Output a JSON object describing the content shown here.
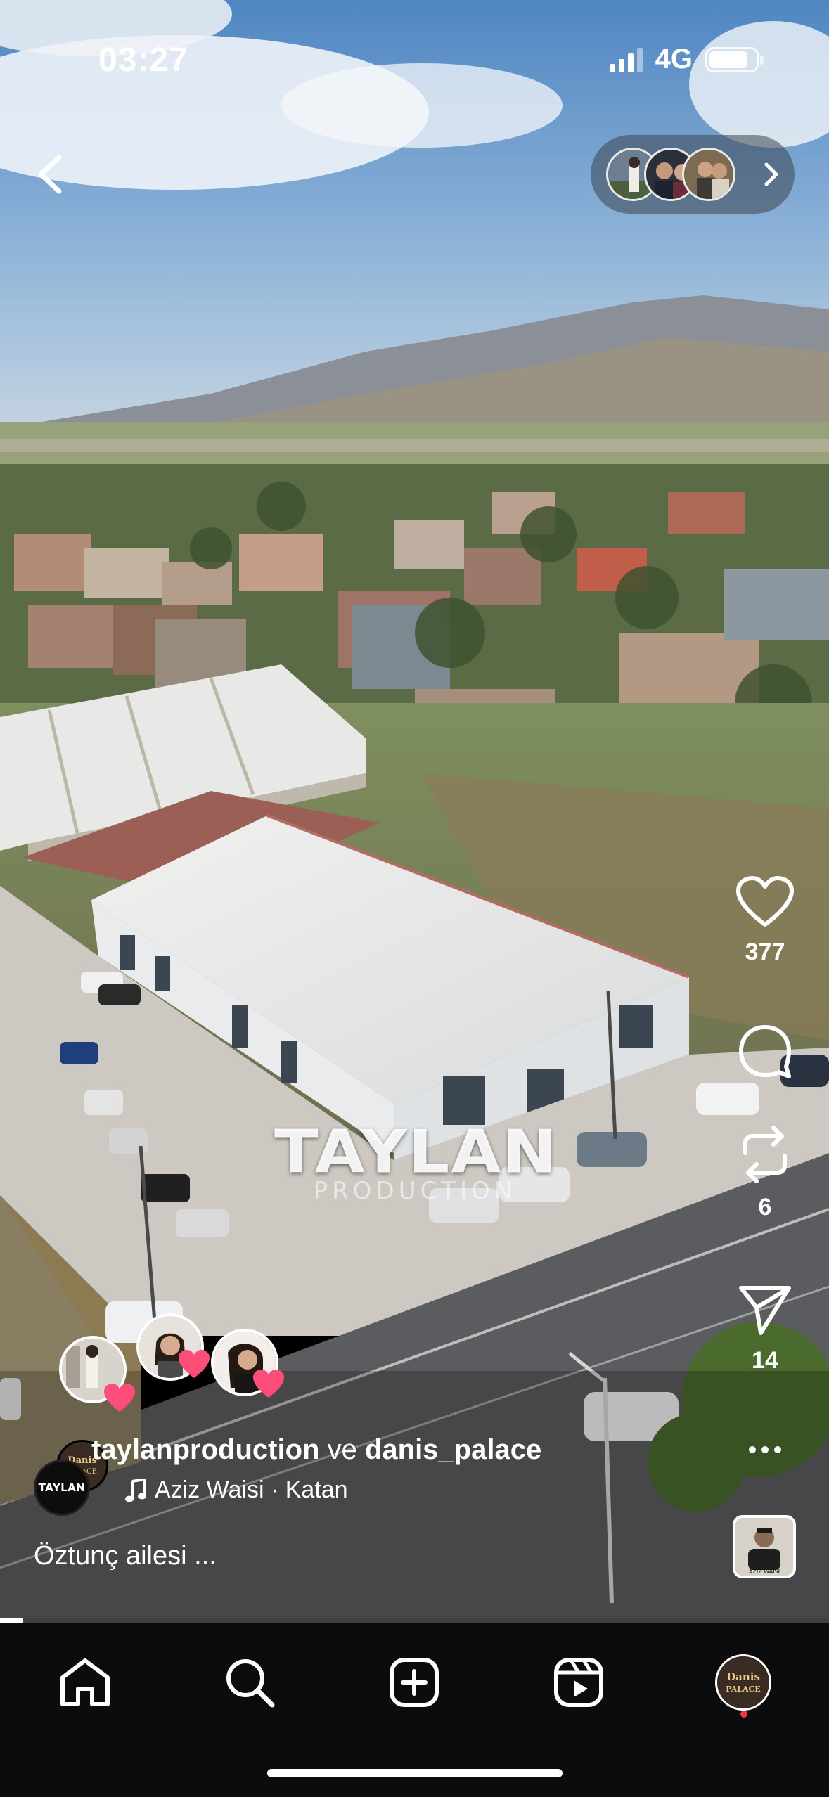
{
  "status_bar": {
    "time": "03:27",
    "network": "4G"
  },
  "video": {
    "watermark_main": "TAYLAN",
    "watermark_sub": "PRODUCTION"
  },
  "actions": {
    "like_count": "377",
    "repost_count": "6",
    "share_count": "14"
  },
  "post": {
    "author_primary": "taylanproduction",
    "conjunction": "ve",
    "author_secondary": "danis_palace",
    "avatar_text": "TAYLAN",
    "audio": "Aziz Waisi · Katan",
    "caption": "Öztunç ailesi ..."
  },
  "audio_thumb_text": "AZIZ WAISI",
  "profile_avatar_text": "Danis PALACE",
  "playback": {
    "progress_fraction": 0.027
  },
  "icons": {
    "back": "chevron-left-icon",
    "stories_next": "chevron-right-icon",
    "like": "heart-icon",
    "comment": "comment-icon",
    "repost": "repost-icon",
    "share": "send-icon",
    "more": "more-icon",
    "music": "music-note-icon",
    "nav": [
      "home-icon",
      "search-icon",
      "create-icon",
      "reels-icon",
      "profile-avatar"
    ]
  },
  "colors": {
    "nav_background": "#0c0c0e",
    "notification_dot": "#ff3040",
    "reaction_heart": "#ff4d7a"
  }
}
